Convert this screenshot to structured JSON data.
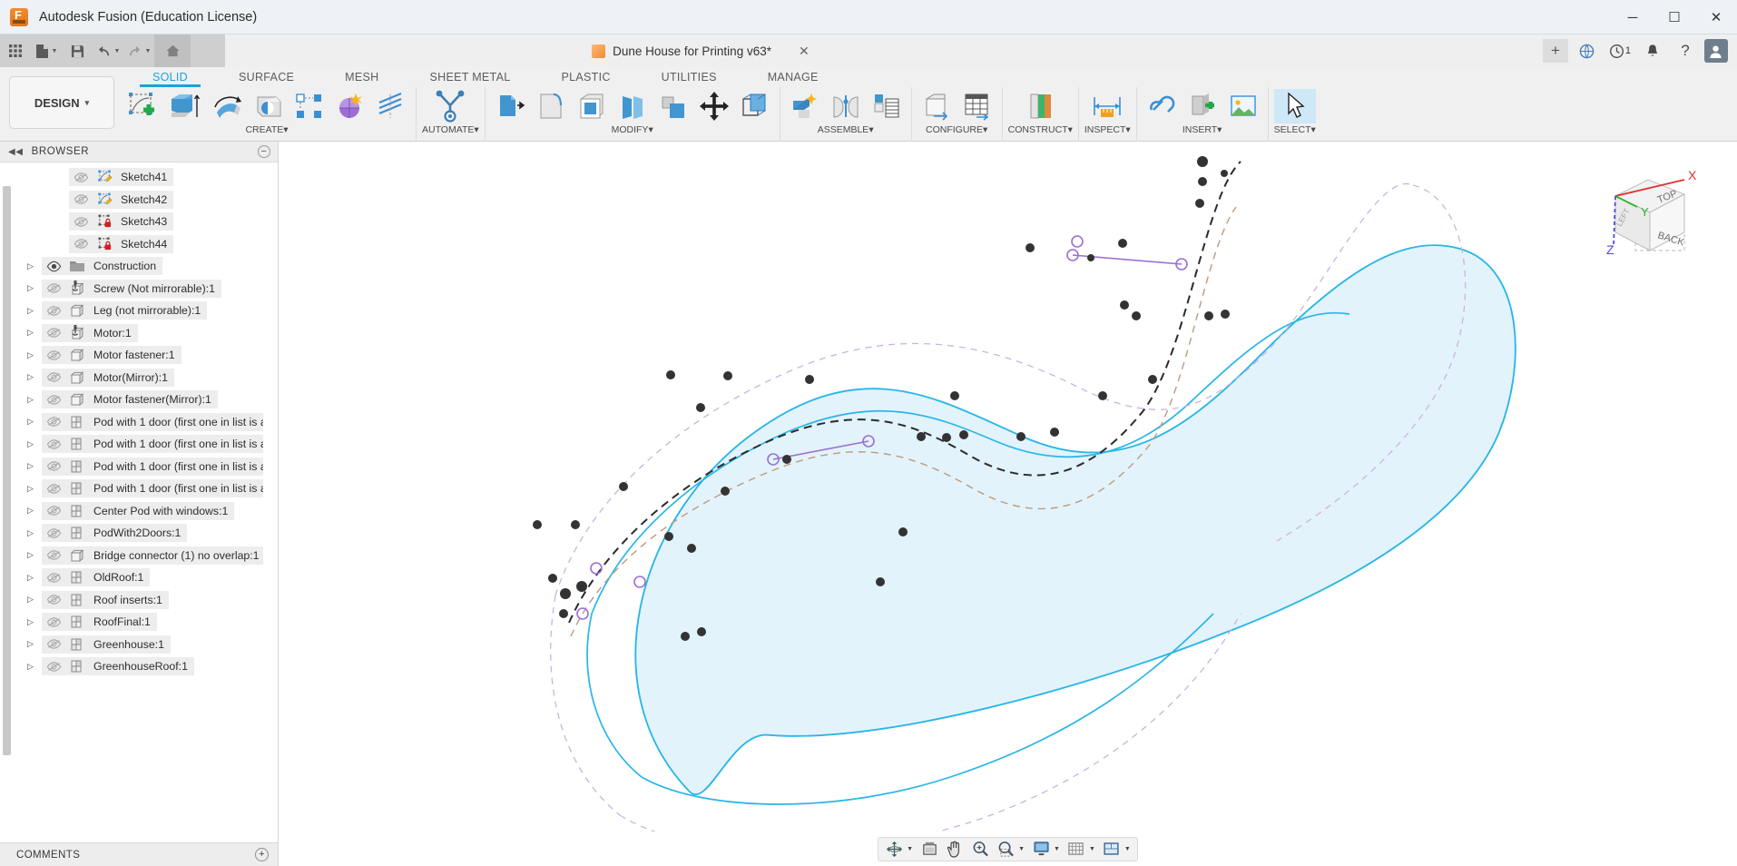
{
  "window": {
    "app_title": "Autodesk Fusion (Education License)",
    "logo_icon": "fusion-logo-icon",
    "minimize_label": "─",
    "maximize_label": "☐",
    "close_label": "✕"
  },
  "quick_access": {
    "items": [
      {
        "name": "app-grid-icon",
        "label": "grid"
      },
      {
        "name": "new-file-icon",
        "label": "new",
        "caret": true
      },
      {
        "name": "save-icon",
        "label": "save"
      },
      {
        "name": "undo-icon",
        "label": "undo",
        "caret": true
      },
      {
        "name": "redo-icon",
        "label": "redo",
        "caret": true
      },
      {
        "name": "home-icon",
        "label": "home"
      }
    ]
  },
  "document_tab": {
    "title": "Dune House for Printing v63*",
    "cube_icon": "orange-cube-icon",
    "close_label": "✕",
    "add_tab_label": "+",
    "extensions_icon": "extensions-icon",
    "job-status-icon": "job-status-icon",
    "job_count": "1",
    "notifications_icon": "bell-icon",
    "help_label": "?",
    "account_icon": "user-avatar-icon"
  },
  "ribbon": {
    "tabs": [
      {
        "label": "SOLID",
        "active": true
      },
      {
        "label": "SURFACE",
        "active": false
      },
      {
        "label": "MESH",
        "active": false
      },
      {
        "label": "SHEET METAL",
        "active": false
      },
      {
        "label": "PLASTIC",
        "active": false
      },
      {
        "label": "UTILITIES",
        "active": false
      },
      {
        "label": "MANAGE",
        "active": false
      }
    ],
    "workspace": {
      "label": "DESIGN",
      "caret": "▾"
    },
    "groups": [
      {
        "label": "CREATE",
        "caret": "▾",
        "tools": [
          {
            "name": "create-sketch-icon"
          },
          {
            "name": "extrude-icon"
          },
          {
            "name": "revolve-icon"
          },
          {
            "name": "sweep-icon"
          },
          {
            "name": "pattern-icon"
          },
          {
            "name": "form-icon"
          },
          {
            "name": "coil-icon"
          }
        ]
      },
      {
        "label": "AUTOMATE",
        "caret": "▾",
        "tools": [
          {
            "name": "automate-icon"
          }
        ]
      },
      {
        "label": "MODIFY",
        "caret": "▾",
        "tools": [
          {
            "name": "press-pull-icon"
          },
          {
            "name": "fillet-icon"
          },
          {
            "name": "shell-icon"
          },
          {
            "name": "draft-icon"
          },
          {
            "name": "scale-icon"
          },
          {
            "name": "move-copy-icon"
          },
          {
            "name": "align-icon"
          }
        ]
      },
      {
        "label": "ASSEMBLE",
        "caret": "▾",
        "tools": [
          {
            "name": "new-component-icon"
          },
          {
            "name": "joint-icon"
          },
          {
            "name": "contact-sets-icon"
          }
        ]
      },
      {
        "label": "CONFIGURE",
        "caret": "▾",
        "tools": [
          {
            "name": "configuration-icon"
          },
          {
            "name": "configuration-table-icon"
          }
        ]
      },
      {
        "label": "CONSTRUCT",
        "caret": "▾",
        "tools": [
          {
            "name": "offset-plane-icon"
          }
        ]
      },
      {
        "label": "INSPECT",
        "caret": "▾",
        "tools": [
          {
            "name": "measure-icon"
          }
        ]
      },
      {
        "label": "INSERT",
        "caret": "▾",
        "tools": [
          {
            "name": "insert-derive-icon"
          },
          {
            "name": "insert-mcmaster-icon"
          },
          {
            "name": "insert-canvas-icon"
          }
        ]
      },
      {
        "label": "SELECT",
        "caret": "▾",
        "tools": [
          {
            "name": "select-cursor-icon"
          }
        ]
      }
    ]
  },
  "browser": {
    "header": "BROWSER",
    "collapse_icon": "collapse-left-icon",
    "minimize_label": "−",
    "items": [
      {
        "label": "Sketch41",
        "icon": "sketch-icon",
        "visible": false,
        "expandable": false,
        "indent": true
      },
      {
        "label": "Sketch42",
        "icon": "sketch-icon",
        "visible": false,
        "expandable": false,
        "indent": true
      },
      {
        "label": "Sketch43",
        "icon": "sketch-locked-icon",
        "visible": false,
        "expandable": false,
        "indent": true
      },
      {
        "label": "Sketch44",
        "icon": "sketch-locked-icon",
        "visible": false,
        "expandable": false,
        "indent": true
      },
      {
        "label": "Construction",
        "icon": "folder-icon",
        "visible": true,
        "expandable": true,
        "indent": false
      },
      {
        "label": "Screw (Not mirrorable):1",
        "icon": "component-anchor-icon",
        "visible": false,
        "expandable": true,
        "indent": false
      },
      {
        "label": "Leg (not mirrorable):1",
        "icon": "body-icon",
        "visible": false,
        "expandable": true,
        "indent": false
      },
      {
        "label": "Motor:1",
        "icon": "component-anchor-icon",
        "visible": false,
        "expandable": true,
        "indent": false
      },
      {
        "label": "Motor fastener:1",
        "icon": "body-icon",
        "visible": false,
        "expandable": true,
        "indent": false
      },
      {
        "label": "Motor(Mirror):1",
        "icon": "body-icon",
        "visible": false,
        "expandable": true,
        "indent": false
      },
      {
        "label": "Motor fastener(Mirror):1",
        "icon": "body-icon",
        "visible": false,
        "expandable": true,
        "indent": false
      },
      {
        "label": "Pod with 1 door (first one in list is a…",
        "icon": "component-icon",
        "visible": false,
        "expandable": true,
        "indent": false
      },
      {
        "label": "Pod with 1 door (first one in list is a…",
        "icon": "component-icon",
        "visible": false,
        "expandable": true,
        "indent": false
      },
      {
        "label": "Pod with 1 door (first one in list is a…",
        "icon": "component-icon",
        "visible": false,
        "expandable": true,
        "indent": false
      },
      {
        "label": "Pod with 1 door (first one in list is a…",
        "icon": "component-icon",
        "visible": false,
        "expandable": true,
        "indent": false
      },
      {
        "label": "Center Pod with windows:1",
        "icon": "component-icon",
        "visible": false,
        "expandable": true,
        "indent": false
      },
      {
        "label": "PodWith2Doors:1",
        "icon": "component-icon",
        "visible": false,
        "expandable": true,
        "indent": false
      },
      {
        "label": "Bridge connector (1) no overlap:1",
        "icon": "body-icon",
        "visible": false,
        "expandable": true,
        "indent": false
      },
      {
        "label": "OldRoof:1",
        "icon": "component-icon",
        "visible": false,
        "expandable": true,
        "indent": false
      },
      {
        "label": "Roof inserts:1",
        "icon": "component-icon",
        "visible": false,
        "expandable": true,
        "indent": false
      },
      {
        "label": "RoofFinal:1",
        "icon": "component-icon",
        "visible": false,
        "expandable": true,
        "indent": false
      },
      {
        "label": "Greenhouse:1",
        "icon": "component-icon",
        "visible": false,
        "expandable": true,
        "indent": false
      },
      {
        "label": "GreenhouseRoof:1",
        "icon": "component-icon",
        "visible": false,
        "expandable": true,
        "indent": false
      }
    ],
    "comments": {
      "label": "COMMENTS",
      "add_label": "+"
    }
  },
  "viewcube": {
    "top_face": "TOP",
    "front_face": "BACK",
    "side_face": "LEFT",
    "axis_x": "X",
    "axis_y": "Y",
    "axis_z": "Z",
    "axis_x_color": "#e03030",
    "axis_y_color": "#23b423",
    "axis_z_color": "#4a4ae0"
  },
  "canvas": {
    "sketch_fill": "#e3f3fb",
    "sketch_stroke": "#29b6e8",
    "construction_stroke": "#cbb3e0",
    "spline_stroke": "#2b2b2b",
    "guide_stroke": "#bd9b7e",
    "point_color": "#333333",
    "highlight_color": "#9b6fd4"
  },
  "bottom_toolbar": {
    "buttons": [
      {
        "name": "orbit-icon",
        "caret": true
      },
      {
        "name": "look-at-icon",
        "caret": false
      },
      {
        "name": "pan-icon",
        "caret": false
      },
      {
        "name": "zoom-icon",
        "caret": false
      },
      {
        "name": "zoom-window-icon",
        "caret": true
      },
      {
        "name": "display-settings-icon",
        "caret": true
      },
      {
        "name": "grid-snaps-icon",
        "caret": true
      },
      {
        "name": "viewports-icon",
        "caret": true
      }
    ]
  }
}
